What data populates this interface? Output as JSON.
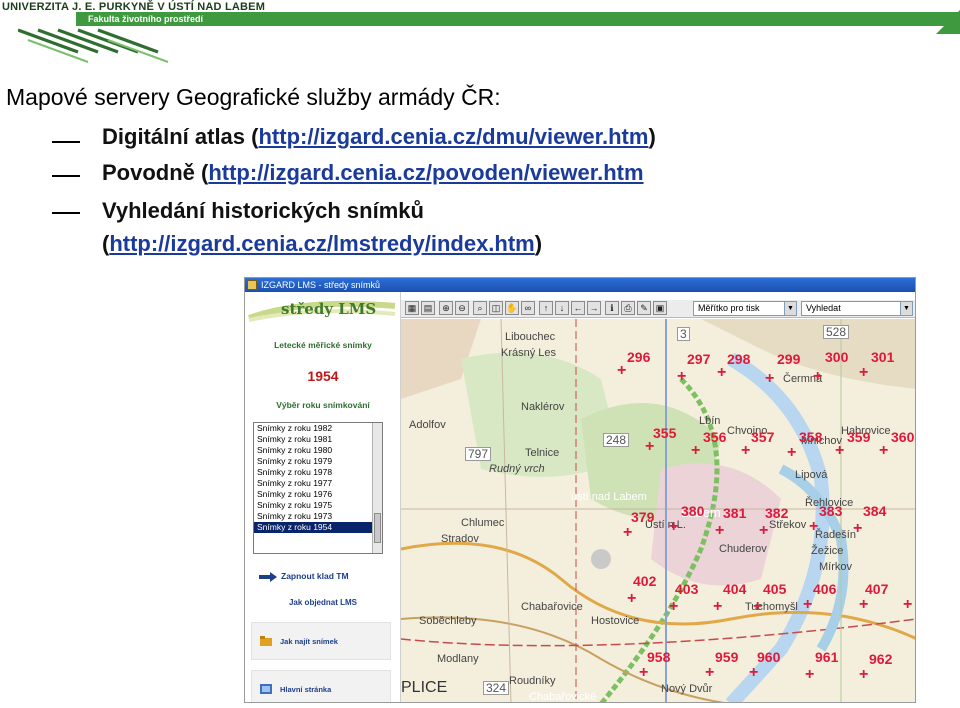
{
  "header": {
    "university": "UNIVERZITA J. E. PURKYNĚ V ÚSTÍ NAD LABEM",
    "faculty": "Fakulta životního prostředí"
  },
  "slide": {
    "title": "Mapové servery Geografické služby armády ČR:",
    "bullets": [
      {
        "text": "Digitální atlas (",
        "link": "http://izgard.cenia.cz/dmu/viewer.htm",
        "after": ")"
      },
      {
        "text": "Povodně (",
        "link": "http://izgard.cenia.cz/povoden/viewer.htm",
        "after": ""
      },
      {
        "text": "Vyhledání historických snímků",
        "line2_open": "(",
        "link": "http://izgard.cenia.cz/lmstredy/index.htm",
        "after": ")"
      }
    ]
  },
  "screenshot": {
    "window_title": "IZGARD LMS - středy snímků",
    "sidebar": {
      "logo_text": "středy LMS",
      "heading": "Letecké měřické snímky",
      "year": "1954",
      "year_heading": "Výběr roku snímkování",
      "years": [
        "Snímky z roku 1982",
        "Snímky z roku 1981",
        "Snímky z roku 1980",
        "Snímky z roku 1979",
        "Snímky z roku 1978",
        "Snímky z roku 1977",
        "Snímky z roku 1976",
        "Snímky z roku 1975",
        "Snímky z roku 1973",
        "Snímky z roku 1954"
      ],
      "selected_year": "Snímky z roku 1954",
      "toggle_tm": "Zapnout klad TM",
      "order_link": "Jak objednat LMS",
      "find_button": "Jak najít snímek",
      "home_button": "Hlavní stránka"
    },
    "toolbar": {
      "scale_select": "Měřítko pro tisk",
      "search_select": "Vyhledat"
    },
    "map": {
      "place_labels": [
        "Krásný Les",
        "Naklérov",
        "Adolfov",
        "Telnice",
        "Rudný vrch",
        "Chlumec",
        "Stradov",
        "Chabařovice",
        "Soběchleby",
        "Modlany",
        "Roudníky",
        "Libouchec",
        "Čermná",
        "Chvojno",
        "Mnichov",
        "Lipová",
        "Řehlovice",
        "Žežice",
        "Mírkov",
        "Habrovice",
        "Chuderov",
        "Tuchomyšl",
        "ústí nad Labem",
        "Labem",
        "Lbín",
        "Ústí n.L.",
        "Střekov",
        "Řadešín",
        "Hostovice",
        "Nový Dvůr",
        "PLICE",
        "Chabařovické"
      ],
      "frame_numbers": [
        "296",
        "297",
        "298",
        "299",
        "300",
        "301",
        "355",
        "356",
        "357",
        "358",
        "359",
        "360",
        "379",
        "380",
        "381",
        "382",
        "383",
        "384",
        "402",
        "403",
        "404",
        "405",
        "406",
        "407",
        "958",
        "959",
        "960",
        "961",
        "962"
      ],
      "grid_numbers": [
        "528",
        "248",
        "797",
        "324",
        "3"
      ]
    },
    "colors": {
      "frame_marker": "#e0183a",
      "titlebar": "#1b4fb0",
      "brand_green": "#3f9a3f"
    }
  }
}
